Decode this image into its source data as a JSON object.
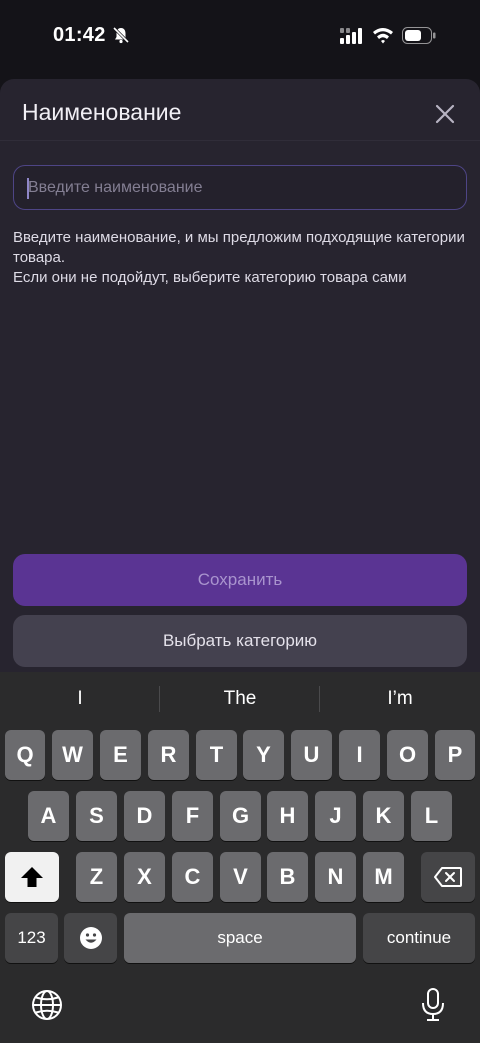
{
  "status_bar": {
    "time": "01:42",
    "icons": [
      "bell-off-icon",
      "signal-icon",
      "wifi-icon",
      "battery-icon"
    ]
  },
  "sheet": {
    "title": "Наименование",
    "close_icon": "close-icon",
    "name_input": {
      "value": "",
      "placeholder": "Введите наименование"
    },
    "hint_line1": "Введите наименование, и мы предложим подходящие категории товара.",
    "hint_line2": "Если они не подойдут, выберите категорию товара сами",
    "save_label": "Сохранить",
    "choose_category_label": "Выбрать категорию"
  },
  "keyboard": {
    "suggestions": [
      "I",
      "The",
      "I’m"
    ],
    "row1": [
      "Q",
      "W",
      "E",
      "R",
      "T",
      "Y",
      "U",
      "I",
      "O",
      "P"
    ],
    "row2": [
      "A",
      "S",
      "D",
      "F",
      "G",
      "H",
      "J",
      "K",
      "L"
    ],
    "row3": [
      "Z",
      "X",
      "C",
      "V",
      "B",
      "N",
      "M"
    ],
    "numbers_label": "123",
    "space_label": "space",
    "return_label": "continue",
    "icons": [
      "shift-icon",
      "backspace-icon",
      "emoji-icon",
      "globe-icon",
      "microphone-icon"
    ]
  },
  "colors": {
    "accent": "#5a3493",
    "sheet_bg": "#27242f",
    "keyboard_bg": "#2b2b2c"
  }
}
